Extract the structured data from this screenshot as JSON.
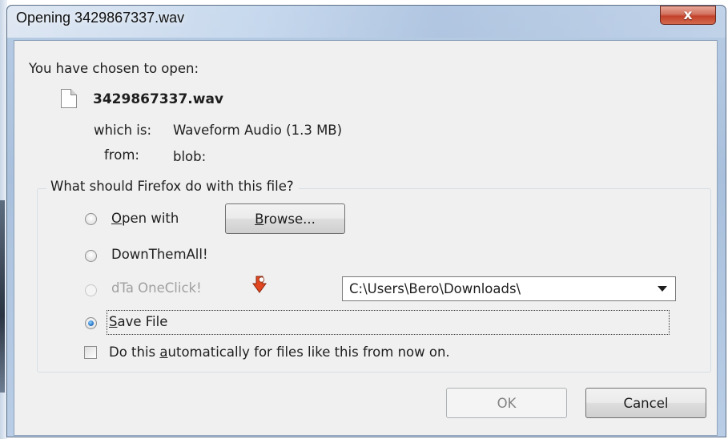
{
  "window": {
    "title": "Opening 3429867337.wav",
    "close_label": "x"
  },
  "file_info": {
    "heading": "You have chosen to open:",
    "filename": "3429867337.wav",
    "which_is_label": "which is:",
    "which_is_value": "Waveform Audio (1.3 MB)",
    "from_label": "from:",
    "from_value": "blob:"
  },
  "action_group": {
    "legend": "What should Firefox do with this file?",
    "open_with": {
      "prefix": "",
      "accel": "O",
      "rest": "pen with",
      "selected": false
    },
    "browse_button": {
      "accel": "B",
      "rest": "rowse..."
    },
    "downthemall": {
      "label": "DownThemAll!",
      "selected": false
    },
    "dta_oneclick": {
      "label": "dTa OneClick!",
      "selected": false,
      "enabled": false
    },
    "download_folder": "C:\\Users\\Bero\\Downloads\\",
    "save_file": {
      "accel": "S",
      "rest": "ave File",
      "selected": true
    },
    "auto_checkbox": {
      "before": "Do this ",
      "accel": "a",
      "after": "utomatically for files like this from now on.",
      "checked": false
    }
  },
  "buttons": {
    "ok_label": "OK",
    "ok_enabled": false,
    "cancel_label": "Cancel"
  },
  "colors": {
    "frame": "#b7cbe4",
    "client_bg": "#f0f0f0",
    "close_red": "#c2412a",
    "radio_checked": "#2a78c8"
  }
}
